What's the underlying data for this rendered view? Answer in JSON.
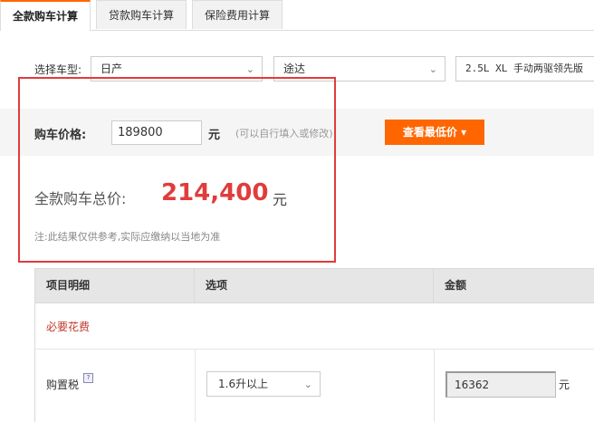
{
  "tabs": [
    {
      "label": "全款购车计算",
      "active": true
    },
    {
      "label": "贷款购车计算",
      "active": false
    },
    {
      "label": "保险费用计算",
      "active": false
    }
  ],
  "model_select": {
    "label": "选择车型:",
    "brand": "日产",
    "series": "途达",
    "variant": "2.5L XL 手动两驱领先版"
  },
  "price": {
    "label": "购车价格:",
    "value": "189800",
    "unit": "元",
    "hint": "(可以自行填入或修改)",
    "lowest_button": "查看最低价 ▾"
  },
  "total": {
    "label": "全款购车总价:",
    "value": "214,400",
    "unit": "元",
    "note": "注:此结果仅供参考,实际应缴纳以当地为准"
  },
  "table": {
    "headers": [
      "项目明细",
      "选项",
      "金额"
    ],
    "section": "必要花费",
    "rows": [
      {
        "name": "购置税",
        "help": "?",
        "option": "1.6升以上",
        "amount": "16362",
        "unit": "元"
      }
    ]
  },
  "colors": {
    "accent": "#ff6600",
    "highlight": "#e03c3c",
    "total": "#e03c3c",
    "section": "#c0392b"
  }
}
